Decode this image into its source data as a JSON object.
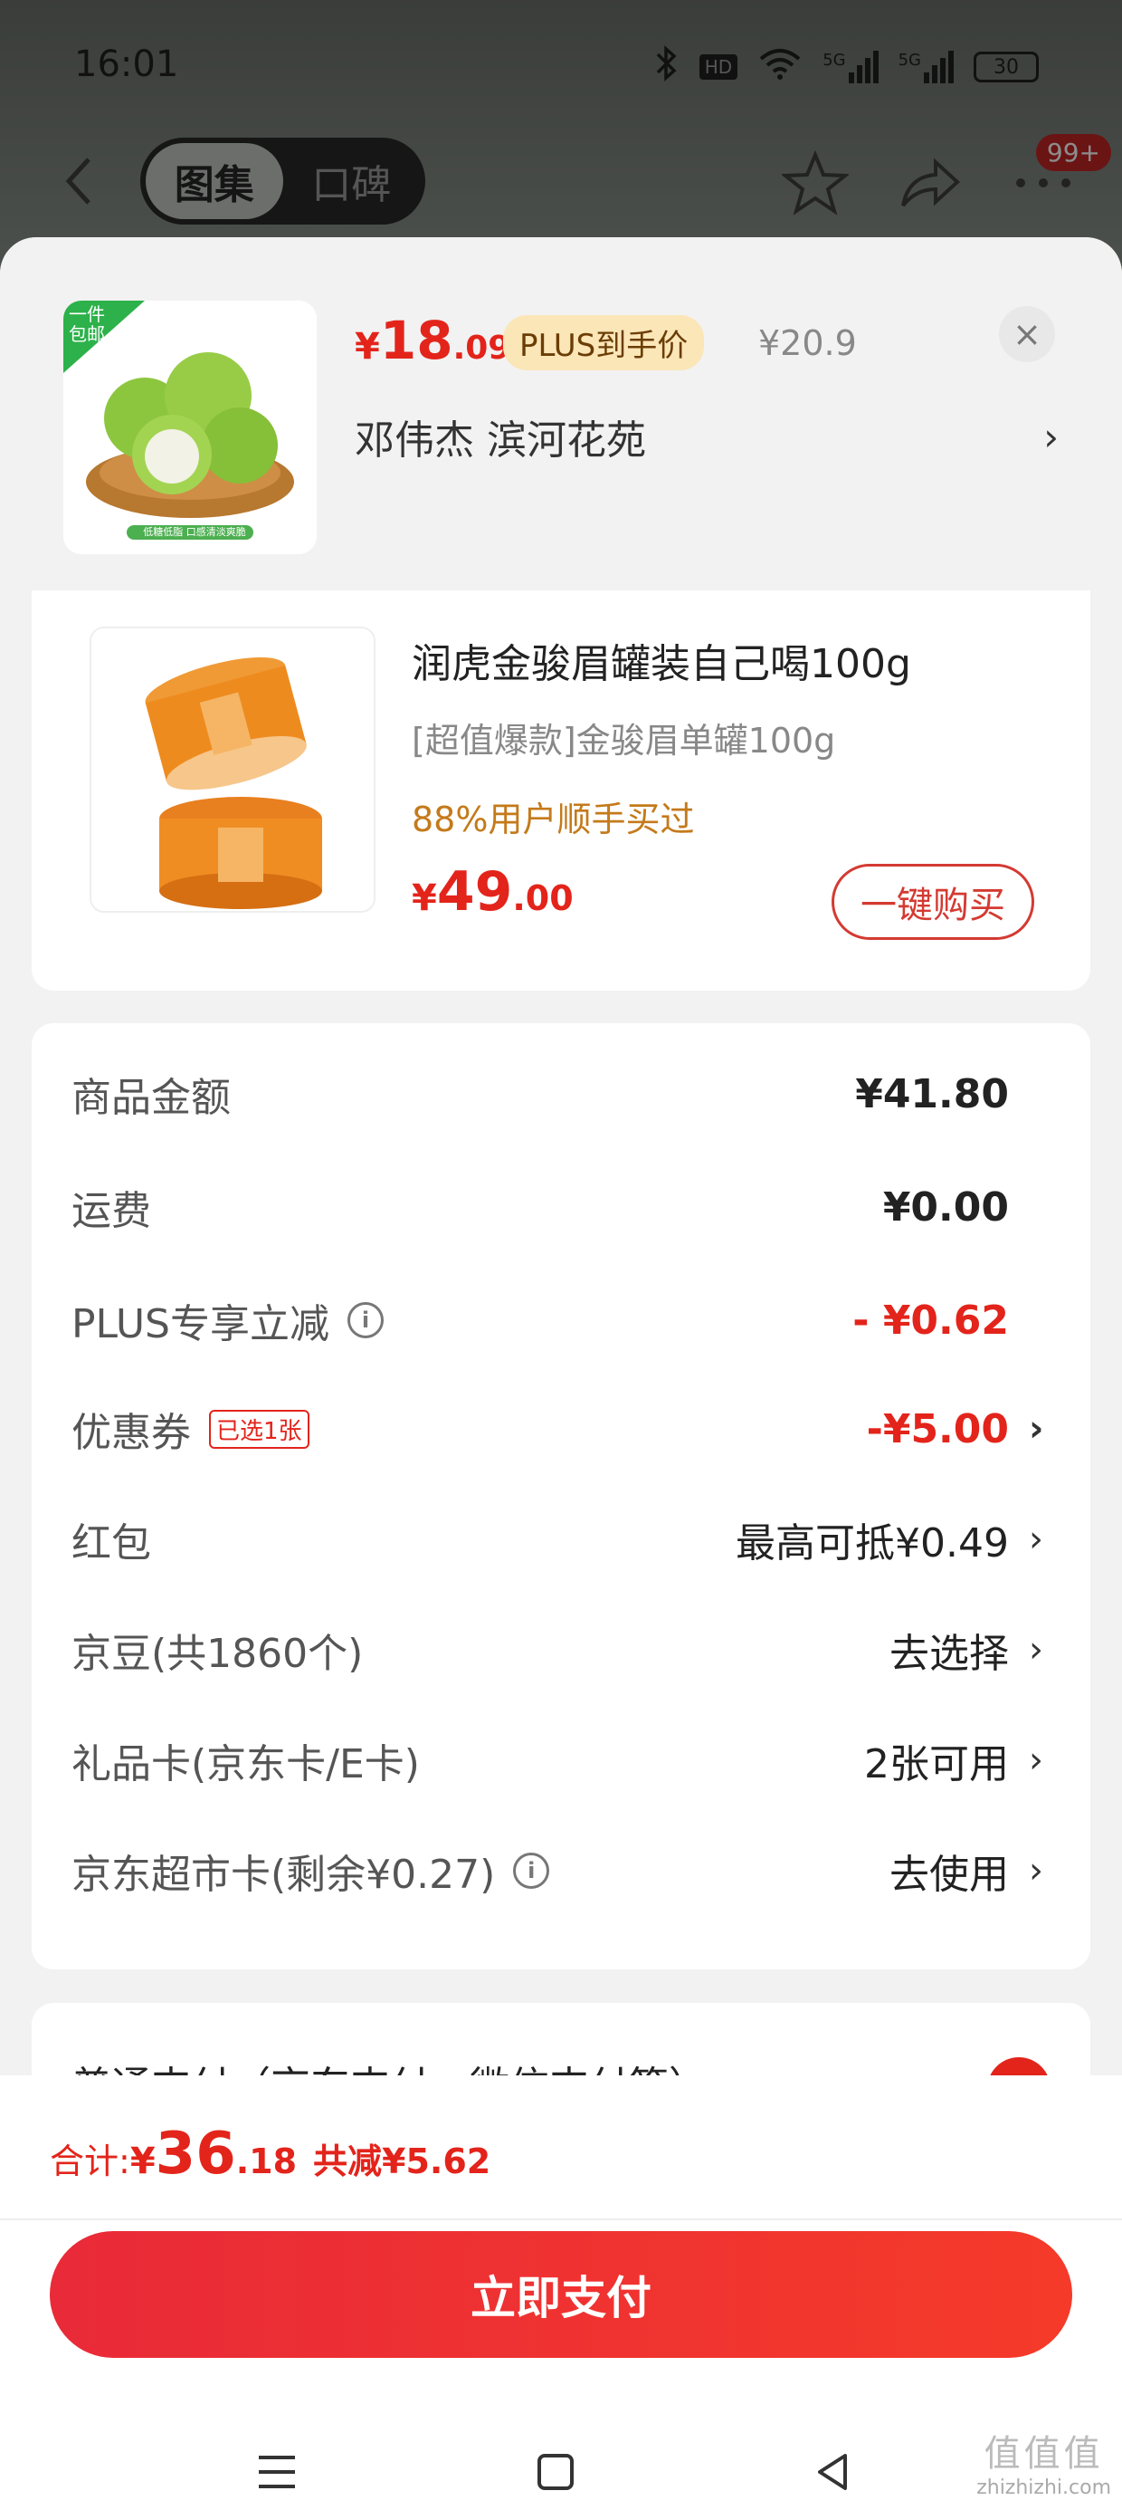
{
  "status_bar": {
    "time": "16:01",
    "battery": "30",
    "hd": "HD",
    "net1": "5G",
    "net2": "5G"
  },
  "header": {
    "tabs": [
      {
        "label": "图集",
        "active": true
      },
      {
        "label": "口碑",
        "active": false
      }
    ],
    "badge": "99+"
  },
  "sheet": {
    "price_symbol": "¥",
    "price_int": "18",
    "price_dec": ".09",
    "plus_tag": "PLUS到手价",
    "original_price": "¥20.9",
    "close_label": "×",
    "address": "邓伟杰  滨河花苑",
    "thumb_tag": "一件\n包邮",
    "thumb_caption": "低糖低脂  口感清淡爽脆"
  },
  "product": {
    "title": "润虎金骏眉罐装自己喝100g",
    "spec": "[超值爆款]金骏眉单罐100g",
    "repurchase": "88%用户顺手买过",
    "price_symbol": "¥",
    "price_int": "49",
    "price_dec": ".00",
    "buy_button": "一键购买"
  },
  "summary": {
    "rows": [
      {
        "label": "商品金额",
        "value": "¥41.80"
      },
      {
        "label": "运费",
        "value": "¥0.00"
      },
      {
        "label": "PLUS专享立减",
        "value": "- ¥0.62"
      },
      {
        "label": "优惠券",
        "tag": "已选1张",
        "value": "-¥5.00"
      },
      {
        "label": "红包",
        "value": "最高可抵¥0.49"
      },
      {
        "label": "京豆(共1860个)",
        "value": "去选择"
      },
      {
        "label": "礼品卡(京东卡/E卡)",
        "value": "2张可用"
      },
      {
        "label": "京东超市卡(剩余¥0.27)",
        "value": "去使用"
      }
    ],
    "info_icon": "i",
    "chevron": "›"
  },
  "payment": {
    "method": "普通支付（京东支付、微信支付等）"
  },
  "bottom": {
    "total_label": "合计: ",
    "total_symbol": "¥",
    "total_int": "36",
    "total_dec": ".18",
    "saved": "共减¥5.62",
    "pay_button": "立即支付"
  },
  "watermark": {
    "big": "值值值",
    "small": "zhizhizhi.com"
  },
  "colors": {
    "accent": "#e3241b",
    "plus_bg": "#fbe6b8",
    "repurchase": "#c47a1a"
  }
}
